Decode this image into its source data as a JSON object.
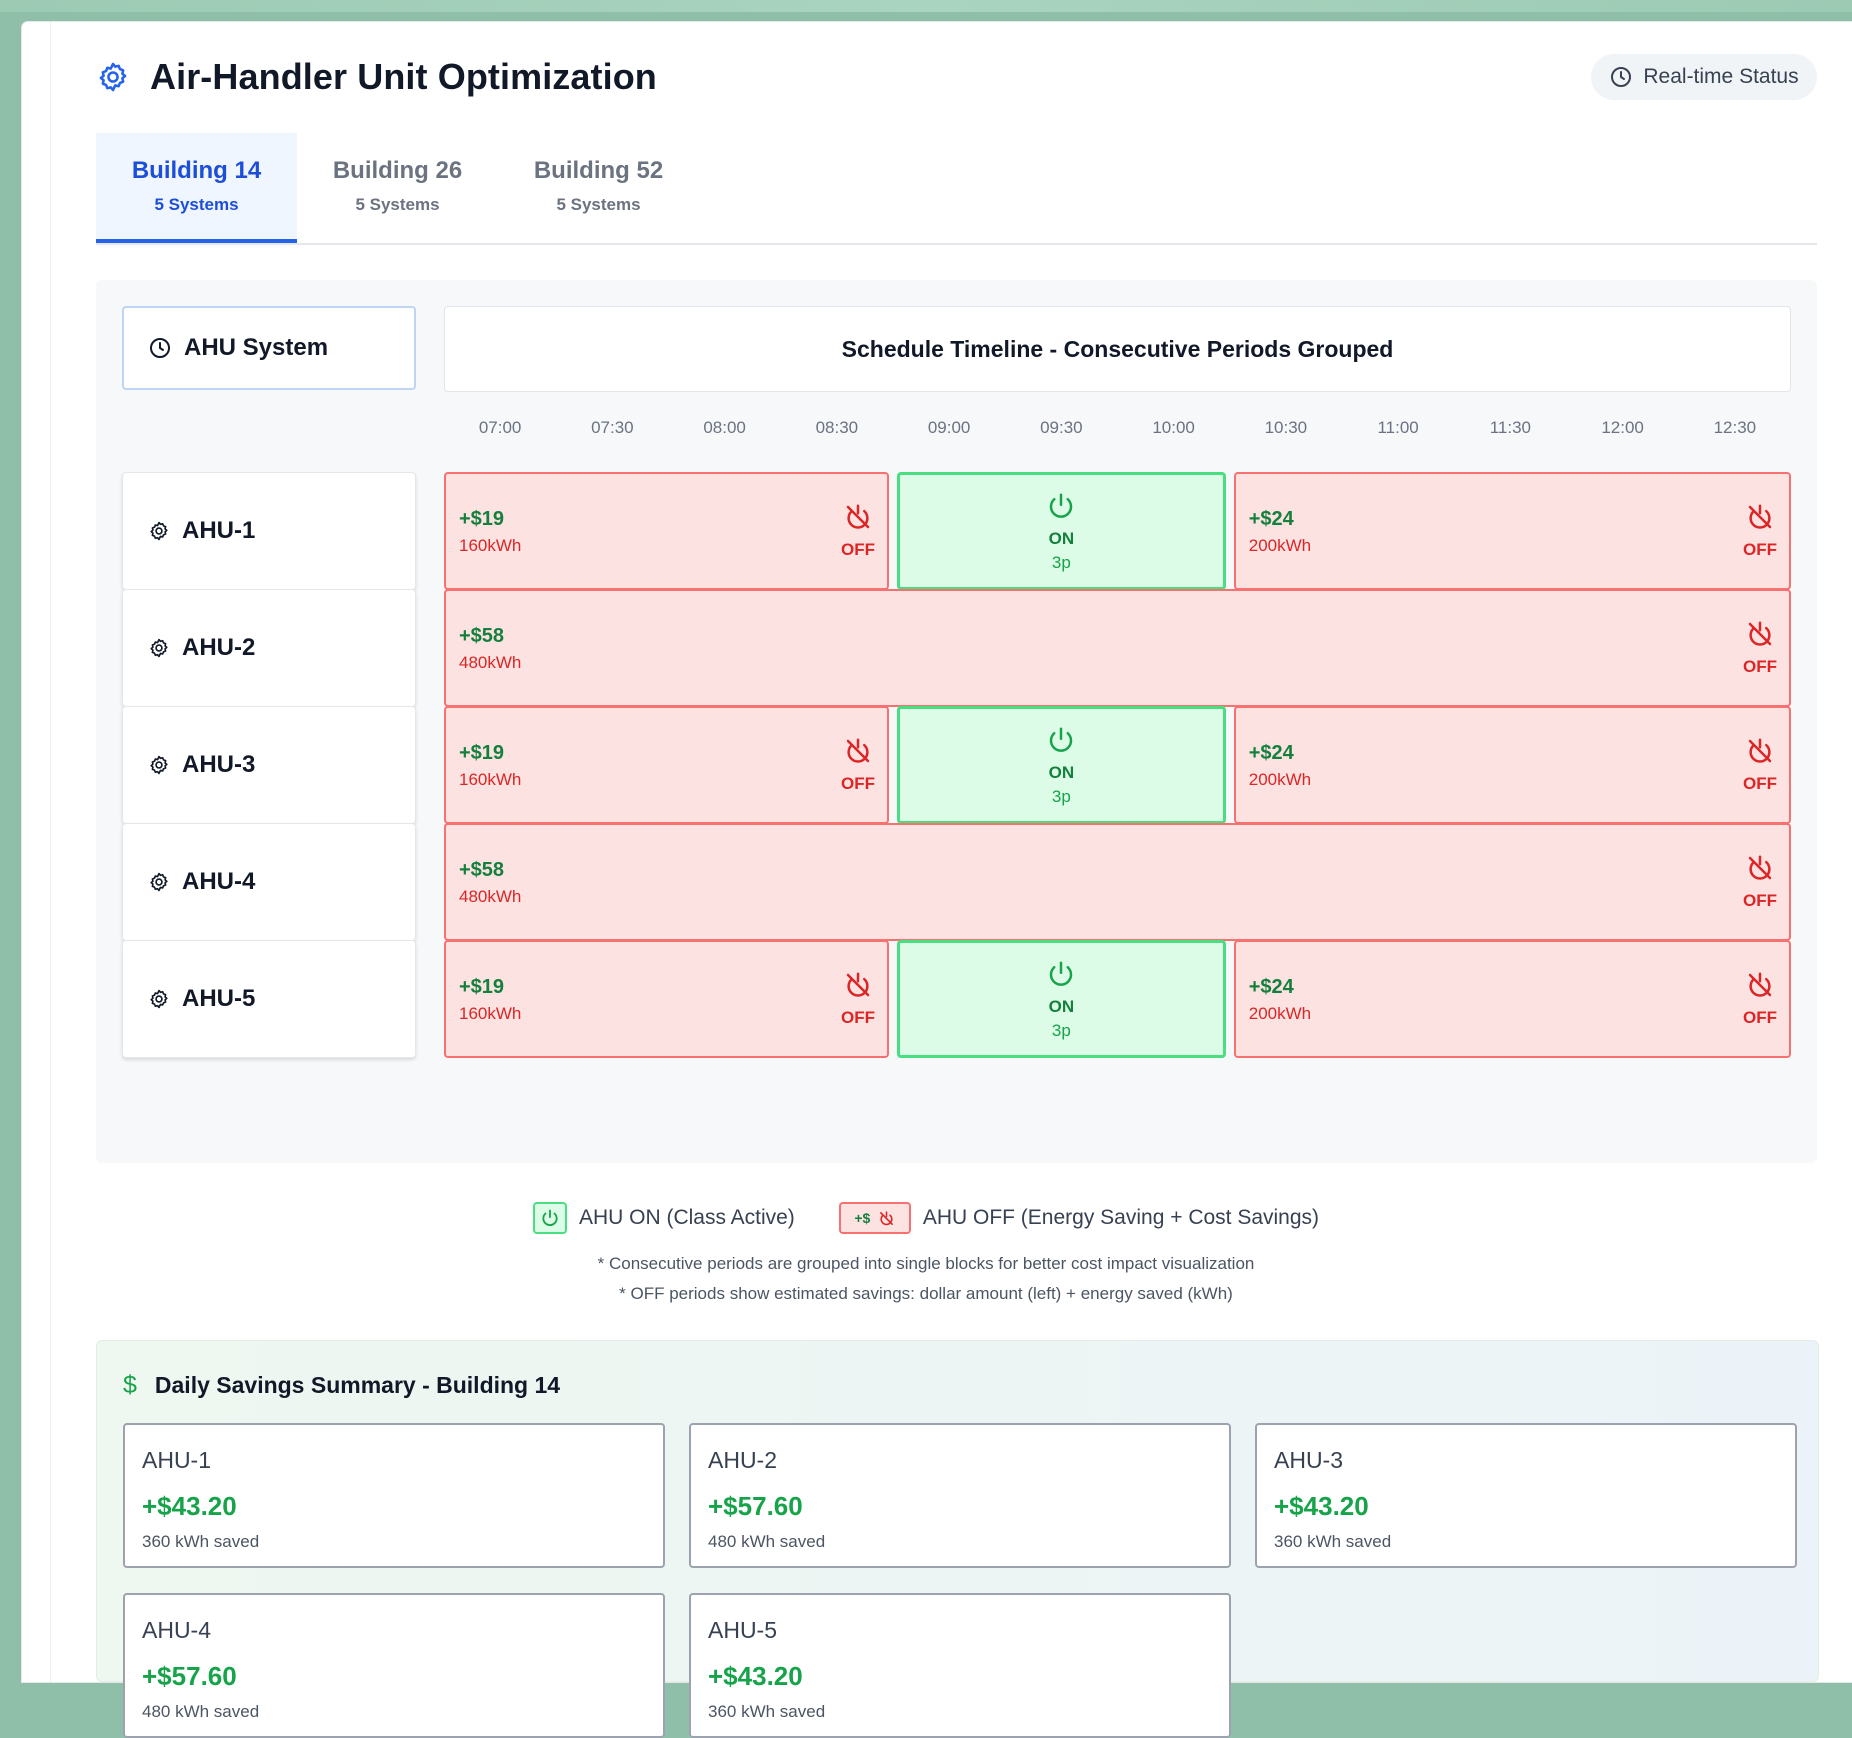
{
  "header": {
    "title": "Air-Handler Unit Optimization",
    "title_icon": "gear-icon",
    "status_label": "Real-time Status",
    "status_icon": "clock-icon"
  },
  "tabs": [
    {
      "label": "Building 14",
      "sub": "5 Systems",
      "active": true
    },
    {
      "label": "Building 26",
      "sub": "5 Systems",
      "active": false
    },
    {
      "label": "Building 52",
      "sub": "5 Systems",
      "active": false
    }
  ],
  "schedule": {
    "system_header": "AHU System",
    "timeline_header": "Schedule Timeline - Consecutive Periods Grouped",
    "times": [
      "07:00",
      "07:30",
      "08:00",
      "08:30",
      "09:00",
      "09:30",
      "10:00",
      "10:30",
      "11:00",
      "11:30",
      "12:00",
      "12:30"
    ],
    "rows": [
      {
        "name": "AHU-1",
        "blocks": [
          {
            "type": "off",
            "span": [
              0,
              4
            ],
            "cost": "+$19",
            "kwh": "160kWh",
            "label": "OFF"
          },
          {
            "type": "on",
            "span": [
              4,
              7
            ],
            "label": "ON",
            "sub": "3p"
          },
          {
            "type": "off",
            "span": [
              7,
              12
            ],
            "cost": "+$24",
            "kwh": "200kWh",
            "label": "OFF"
          }
        ]
      },
      {
        "name": "AHU-2",
        "blocks": [
          {
            "type": "off",
            "span": [
              0,
              12
            ],
            "cost": "+$58",
            "kwh": "480kWh",
            "label": "OFF"
          }
        ]
      },
      {
        "name": "AHU-3",
        "blocks": [
          {
            "type": "off",
            "span": [
              0,
              4
            ],
            "cost": "+$19",
            "kwh": "160kWh",
            "label": "OFF"
          },
          {
            "type": "on",
            "span": [
              4,
              7
            ],
            "label": "ON",
            "sub": "3p"
          },
          {
            "type": "off",
            "span": [
              7,
              12
            ],
            "cost": "+$24",
            "kwh": "200kWh",
            "label": "OFF"
          }
        ]
      },
      {
        "name": "AHU-4",
        "blocks": [
          {
            "type": "off",
            "span": [
              0,
              12
            ],
            "cost": "+$58",
            "kwh": "480kWh",
            "label": "OFF"
          }
        ]
      },
      {
        "name": "AHU-5",
        "blocks": [
          {
            "type": "off",
            "span": [
              0,
              4
            ],
            "cost": "+$19",
            "kwh": "160kWh",
            "label": "OFF"
          },
          {
            "type": "on",
            "span": [
              4,
              7
            ],
            "label": "ON",
            "sub": "3p"
          },
          {
            "type": "off",
            "span": [
              7,
              12
            ],
            "cost": "+$24",
            "kwh": "200kWh",
            "label": "OFF"
          }
        ]
      }
    ]
  },
  "legend": {
    "on_label": "AHU ON (Class Active)",
    "off_chip": "+$",
    "off_label": "AHU OFF (Energy Saving + Cost Savings)",
    "note1": "* Consecutive periods are grouped into single blocks for better cost impact visualization",
    "note2": "* OFF periods show estimated savings: dollar amount (left) + energy saved (kWh)"
  },
  "summary": {
    "icon": "$",
    "title": "Daily Savings Summary - Building 14",
    "cards": [
      {
        "name": "AHU-1",
        "amount": "+$43.20",
        "saved": "360 kWh saved"
      },
      {
        "name": "AHU-2",
        "amount": "+$57.60",
        "saved": "480 kWh saved"
      },
      {
        "name": "AHU-3",
        "amount": "+$43.20",
        "saved": "360 kWh saved"
      },
      {
        "name": "AHU-4",
        "amount": "+$57.60",
        "saved": "480 kWh saved"
      },
      {
        "name": "AHU-5",
        "amount": "+$43.20",
        "saved": "360 kWh saved"
      }
    ]
  },
  "colors": {
    "accent": "#2563eb",
    "off_bg": "#fde2e2",
    "off_border": "#f87171",
    "on_bg": "#dcfce7",
    "on_border": "#4ade80",
    "savings_green": "#16a34a"
  }
}
